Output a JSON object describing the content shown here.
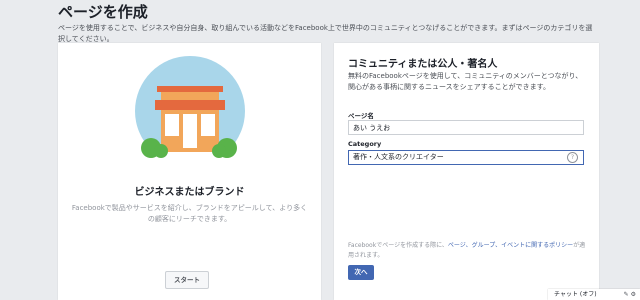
{
  "header": {
    "title": "ページを作成",
    "description": "ページを使用することで、ビジネスや自分自身、取り組んでいる活動などをFacebook上で世界中のコミュニティとつなげることができます。まずはページのカテゴリを選択してください。"
  },
  "business_card": {
    "title": "ビジネスまたはブランド",
    "description": "Facebookで製品やサービスを紹介し、ブランドをアピールして、より多くの顧客にリーチできます。",
    "start_button": "スタート",
    "illustration": "storefront-icon",
    "colors": {
      "circle": "#a9d6ea",
      "roof": "#e4693e",
      "wall": "#f2a65a",
      "door": "#ffffff",
      "bush": "#59b34a"
    }
  },
  "community_card": {
    "title": "コミュニティまたは公人・著名人",
    "description": "無料のFacebookページを使用して、コミュニティのメンバーとつながり、関心がある事柄に関するニュースをシェアすることができます。",
    "page_name_label": "ページ名",
    "page_name_value": "あい うえお",
    "category_label": "Category",
    "category_value": "著作・人文系のクリエイター",
    "help_icon": "?",
    "terms_prefix": "Facebookでページを作成する際に、",
    "terms_link1": "ページ、グループ、イベントに関するポリシー",
    "terms_suffix": "が適用されます。",
    "next_button": "次へ",
    "colors": {
      "accent": "#4267b2"
    }
  },
  "chat": {
    "label": "チャット (オフ)",
    "icons": "✎ ⚙"
  }
}
